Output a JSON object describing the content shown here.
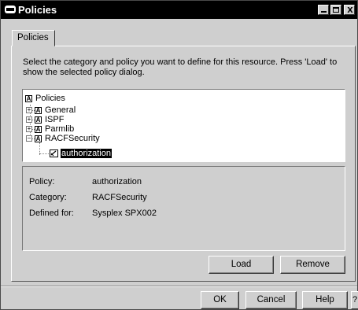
{
  "window": {
    "title": "Policies",
    "controls": {
      "minimize": "_",
      "maximize": "□",
      "close": "x"
    },
    "title_icon": "window-app-icon"
  },
  "tabs": [
    {
      "label": "Policies",
      "selected": true
    }
  ],
  "instructions": "Select the category and policy you want to define for this resource. Press 'Load' to show the selected policy dialog.",
  "tree": {
    "root": {
      "label": "Policies",
      "icon": "policy-folder-icon"
    },
    "items": [
      {
        "label": "General",
        "expanded": false,
        "icon": "policy-folder-icon"
      },
      {
        "label": "ISPF",
        "expanded": false,
        "icon": "policy-folder-icon"
      },
      {
        "label": "Parmlib",
        "expanded": false,
        "icon": "policy-folder-icon"
      },
      {
        "label": "RACFSecurity",
        "expanded": true,
        "icon": "policy-folder-icon",
        "children": [
          {
            "label": "authorization",
            "selected": true,
            "icon": "policy-doc-icon"
          }
        ]
      }
    ]
  },
  "details": {
    "policy_label": "Policy:",
    "policy_value": "authorization",
    "category_label": "Category:",
    "category_value": "RACFSecurity",
    "defined_for_label": "Defined for:",
    "defined_for_value": "Sysplex SPX002"
  },
  "buttons": {
    "load": "Load",
    "remove": "Remove",
    "ok": "OK",
    "cancel": "Cancel",
    "help": "Help",
    "question": "?"
  },
  "colors": {
    "title_bar": "#000000",
    "panel": "#cfcfcf",
    "selection": "#000000"
  }
}
